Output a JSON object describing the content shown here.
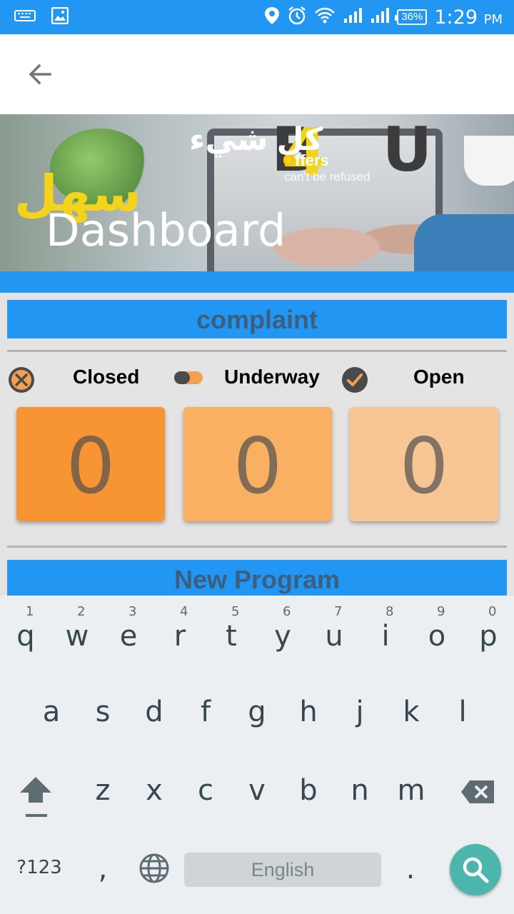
{
  "status_bar": {
    "battery": "36%",
    "time": "1:29",
    "ampm": "PM",
    "icons": [
      "keyboard-icon",
      "image-icon",
      "location-icon",
      "alarm-icon",
      "wifi-icon",
      "signal-icon",
      "signal-icon",
      "battery-icon"
    ]
  },
  "toolbar": {
    "back_icon": "arrow-back-icon"
  },
  "banner": {
    "brand_b": "B",
    "brand_4": "4",
    "brand_u": "U",
    "offers": "ffers",
    "offers_o": "O",
    "tagline": "can't be refused",
    "arabic_line1": "كل شيء",
    "arabic_line2": "سهل",
    "title": "Dashboard"
  },
  "complaint": {
    "header": "complaint",
    "statuses": [
      {
        "label": "Closed",
        "icon": "close-circle-icon"
      },
      {
        "label": "Underway",
        "icon": "toggle-icon"
      },
      {
        "label": "Open",
        "icon": "check-circle-icon"
      }
    ],
    "counts": [
      {
        "value": "0",
        "color": "#f79433"
      },
      {
        "value": "0",
        "color": "#f9b062"
      },
      {
        "value": "0",
        "color": "#f8c594"
      }
    ]
  },
  "new_program": {
    "header": "New Program"
  },
  "keyboard": {
    "row1": [
      "q",
      "w",
      "e",
      "r",
      "t",
      "y",
      "u",
      "i",
      "o",
      "p"
    ],
    "row1_hints": [
      "1",
      "2",
      "3",
      "4",
      "5",
      "6",
      "7",
      "8",
      "9",
      "0"
    ],
    "row2": [
      "a",
      "s",
      "d",
      "f",
      "g",
      "h",
      "j",
      "k",
      "l"
    ],
    "row3": [
      "z",
      "x",
      "c",
      "v",
      "b",
      "n",
      "m"
    ],
    "symbols_key": "?123",
    "comma_key": ",",
    "period_key": ".",
    "space_label": "English",
    "shift_icon": "shift-icon",
    "backspace_icon": "backspace-icon",
    "globe_icon": "globe-icon",
    "search_icon": "search-icon"
  },
  "colors": {
    "primary": "#2196f3",
    "closed": "#f79433",
    "underway": "#f9b062",
    "open": "#f8c594",
    "fab": "#4db6ac"
  }
}
